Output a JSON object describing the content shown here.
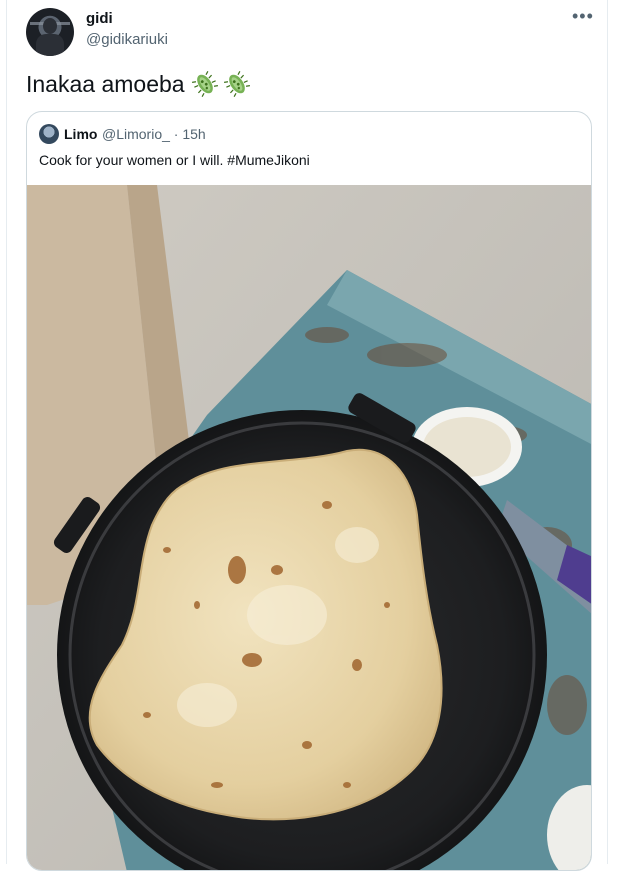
{
  "tweet": {
    "display_name": "gidi",
    "handle": "@gidikariuki",
    "text": "Inakaa amoeba",
    "emoji": [
      "microbe-icon",
      "microbe-icon"
    ],
    "more_icon": "more-icon"
  },
  "quoted_tweet": {
    "display_name": "Limo",
    "handle_time": "@Limorio_ · 15h",
    "text": "Cook for your women or I will. #MumeJikoni",
    "image_description": "flatbread on black pan"
  }
}
